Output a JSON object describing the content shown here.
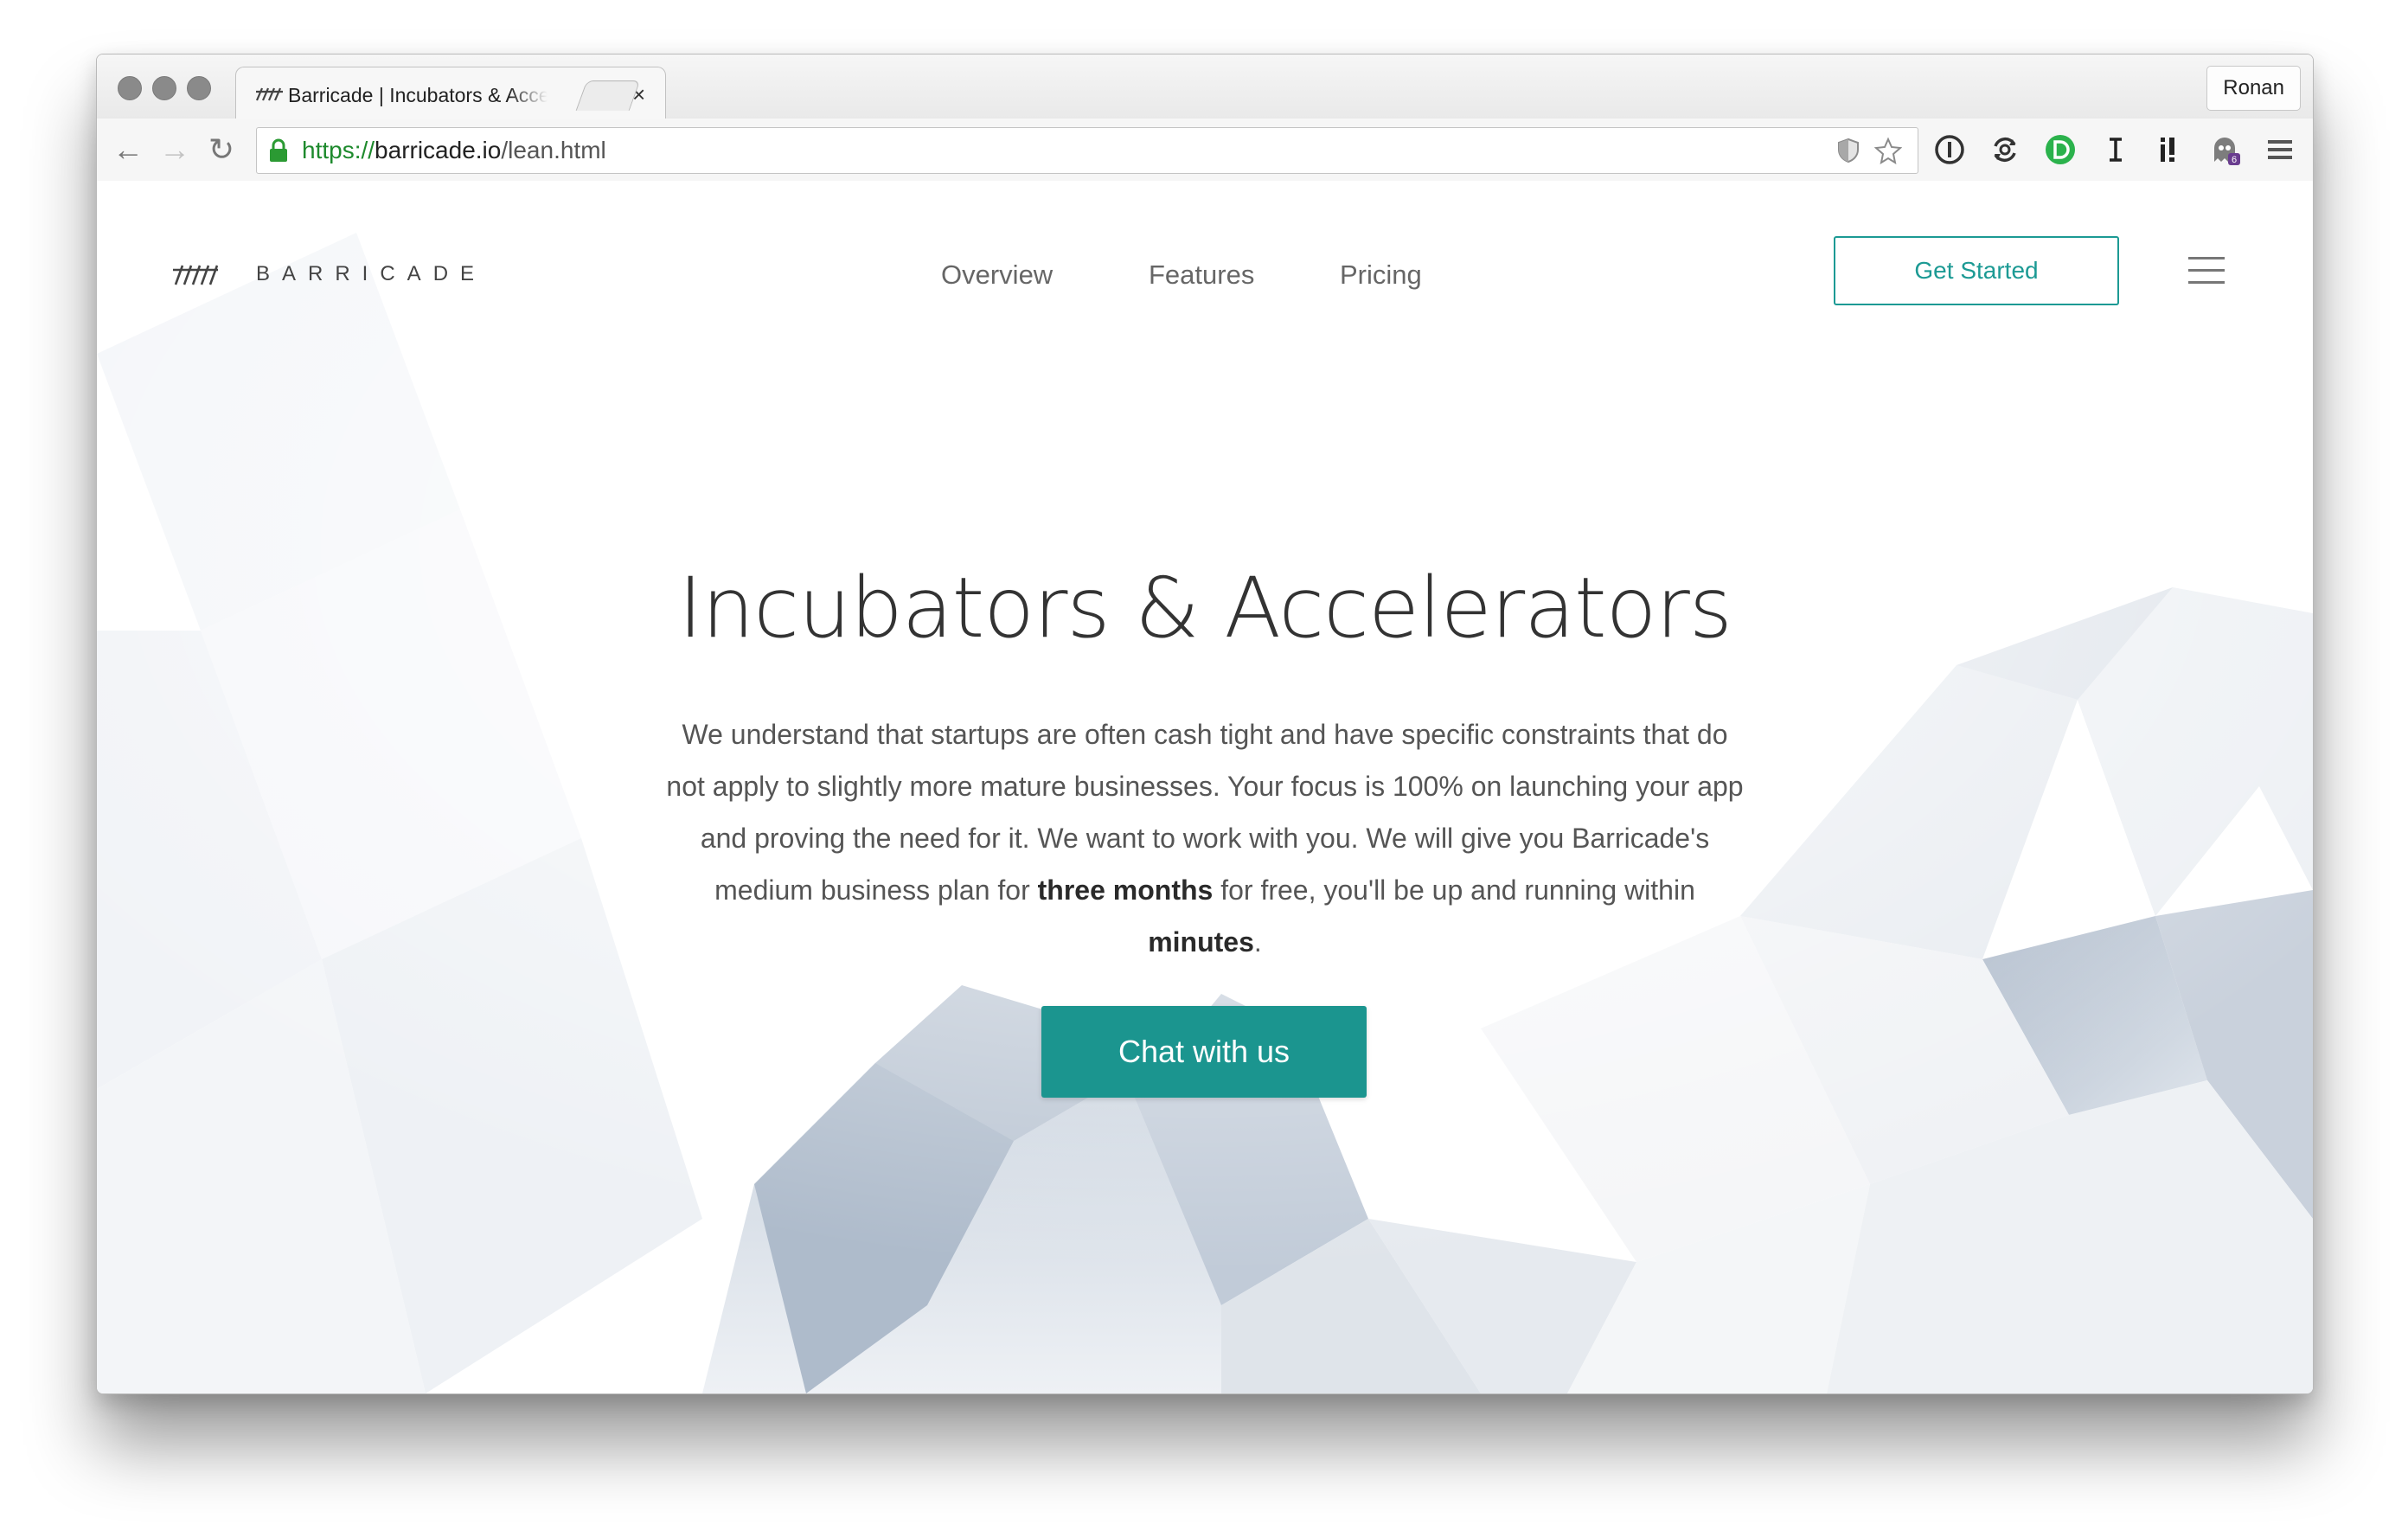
{
  "browser": {
    "tab_title": "Barricade | Incubators & Accelerators",
    "tab_close": "×",
    "profile": "Ronan",
    "url": {
      "scheme": "https://",
      "host": "barricade.io",
      "path": "/lean.html"
    },
    "nav_icons": {
      "back": "←",
      "forward": "→",
      "reload": "↻"
    },
    "extensions": [
      "shield-icon",
      "star-icon",
      "onepassword-icon",
      "sync-icon",
      "d-icon",
      "i-icon",
      "ib-icon",
      "ghost-icon",
      "menu-icon"
    ],
    "ghost_badge": "6"
  },
  "site": {
    "brand": "BARRICADE",
    "nav": [
      "Overview",
      "Features",
      "Pricing"
    ],
    "cta_top": "Get Started",
    "accent_color": "#1c9a94"
  },
  "hero": {
    "title": "Incubators & Accelerators",
    "paragraph_parts": {
      "p1": "We understand that startups are often cash tight and have specific constraints that do not apply to slightly more mature businesses. Your focus is 100% on launching your app and proving the need for it. We want to work with you. We will give you Barricade's medium business plan for ",
      "b1": "three months",
      "p2": " for free, you'll be up and running within ",
      "b2": "minutes",
      "p3": "."
    },
    "cta": "Chat with us"
  }
}
